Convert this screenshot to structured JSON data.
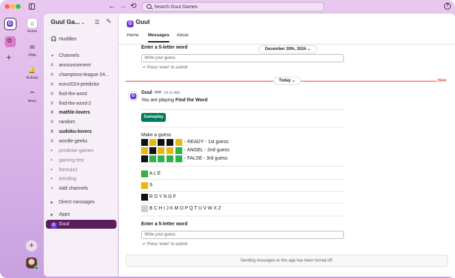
{
  "titlebar": {
    "search_placeholder": "Search Guul Games",
    "back": "←",
    "forward": "→",
    "history": "⟲",
    "help": "?"
  },
  "rail": {
    "workspace_initial": "G"
  },
  "nav": [
    {
      "label": "Home",
      "icon": "⌂"
    },
    {
      "label": "DMs",
      "icon": "✉"
    },
    {
      "label": "Activity",
      "icon": "🔔"
    },
    {
      "label": "More",
      "icon": "•••"
    }
  ],
  "sidebar": {
    "workspace_name": "Guul Ga...",
    "workspace_chevron": "⌄",
    "huddles": "Huddles",
    "channels_header": "Channels",
    "channels": [
      {
        "name": "announcement",
        "style": ""
      },
      {
        "name": "champions-league-24...",
        "style": ""
      },
      {
        "name": "euro2024-predictor",
        "style": ""
      },
      {
        "name": "find-the-word",
        "style": ""
      },
      {
        "name": "find-the-word-2",
        "style": ""
      },
      {
        "name": "mathle-lovers",
        "style": "bold"
      },
      {
        "name": "random",
        "style": ""
      },
      {
        "name": "sudoku-lovers",
        "style": "bold"
      },
      {
        "name": "wordle-geeks",
        "style": ""
      },
      {
        "name": "predictor-games",
        "style": "muted"
      },
      {
        "name": "gaming-test",
        "style": "muted"
      },
      {
        "name": "formula1",
        "style": "muted"
      },
      {
        "name": "trending",
        "style": "muted"
      }
    ],
    "add_channels": "Add channels",
    "direct_messages": "Direct messages",
    "apps": "Apps",
    "selected_app": "Guul"
  },
  "main": {
    "channel_name": "Guul",
    "tabs": [
      "Home",
      "Messages",
      "About"
    ],
    "top_prompt": "Enter a 5-letter word",
    "top_input_placeholder": "Write your guess",
    "top_hint": "↵ Press 'enter' to submit",
    "date_pill": "December 20th, 2024",
    "today_pill": "Today",
    "new_label": "New",
    "sender": "Guul",
    "app_badge": "APP",
    "time": "10:11 AM",
    "intro_prefix": "You are playing ",
    "intro_game": "Find the Word",
    "gameplay_button": "Gameplay",
    "make_guess": "Make a guess",
    "guesses": [
      {
        "tiles": [
          "k",
          "y",
          "k",
          "k",
          "y"
        ],
        "label": "- READY - 1st guess"
      },
      {
        "tiles": [
          "y",
          "k",
          "y",
          "y",
          "gr"
        ],
        "label": "- ANGEL - 2nd guess"
      },
      {
        "tiles": [
          "k",
          "gr",
          "gr",
          "gr",
          "gr"
        ],
        "label": "- FALSE - 3rd guess"
      }
    ],
    "legend": [
      {
        "color": "gr",
        "letters": "A L E"
      },
      {
        "color": "y",
        "letters": "S"
      },
      {
        "color": "k",
        "letters": "R D Y N G F"
      },
      {
        "color": "gy",
        "letters": "B C H I J K M O P Q T U V W X Z"
      }
    ],
    "bottom_prompt": "Enter a 5-letter word",
    "bottom_input_placeholder": "Write your guess",
    "bottom_hint": "↵ Press 'enter' to submit",
    "footer_note": "Sending messages to this app has been turned off."
  }
}
